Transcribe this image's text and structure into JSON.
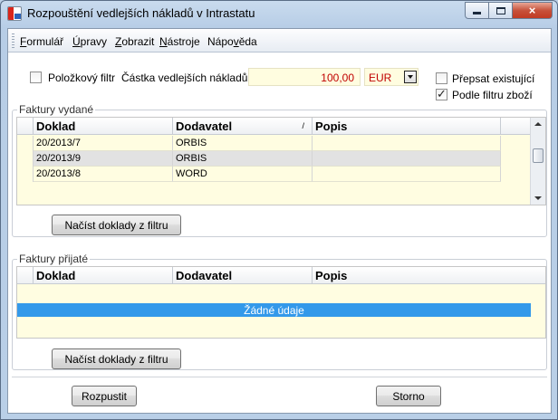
{
  "window": {
    "title": "Rozpouštění vedlejších nákladů v Intrastatu",
    "close_symbol": "×"
  },
  "menu": [
    "Formulář",
    "Úpravy",
    "Zobrazit",
    "Nástroje",
    "Nápověda"
  ],
  "menu_hotkeys": [
    "F",
    "Ú",
    "Z",
    "N",
    "v"
  ],
  "filters": {
    "item_filter_label": "Položkový filtr",
    "item_filter_checked": false,
    "amount_label": "Částka vedlejších nákladů:",
    "amount_value": "100,00",
    "currency_value": "EUR",
    "overwrite_label": "Přepsat existující",
    "overwrite_checked": false,
    "goods_filter_label": "Podle filtru zboží",
    "goods_filter_checked": true
  },
  "issued": {
    "group_title": "Faktury vydané",
    "columns": [
      "Doklad",
      "Dodavatel",
      "Popis"
    ],
    "sort_indicator": "/",
    "rows": [
      {
        "doklad": "20/2013/7",
        "dodavatel": "ORBIS",
        "popis": ""
      },
      {
        "doklad": "20/2013/9",
        "dodavatel": "ORBIS",
        "popis": ""
      },
      {
        "doklad": "20/2013/8",
        "dodavatel": "WORD",
        "popis": ""
      }
    ],
    "load_button": "Načíst doklady z filtru"
  },
  "received": {
    "group_title": "Faktury přijaté",
    "columns": [
      "Doklad",
      "Dodavatel",
      "Popis"
    ],
    "empty_text": "Žádné údaje",
    "load_button": "Načíst doklady z filtru"
  },
  "footer": {
    "dissolve_button": "Rozpustit",
    "cancel_button": "Storno"
  },
  "colors": {
    "grid_bg": "#fffde1",
    "selected_row": "#e2e2e2",
    "nodata_bar": "#3399ea",
    "amount_text": "#c00000"
  }
}
